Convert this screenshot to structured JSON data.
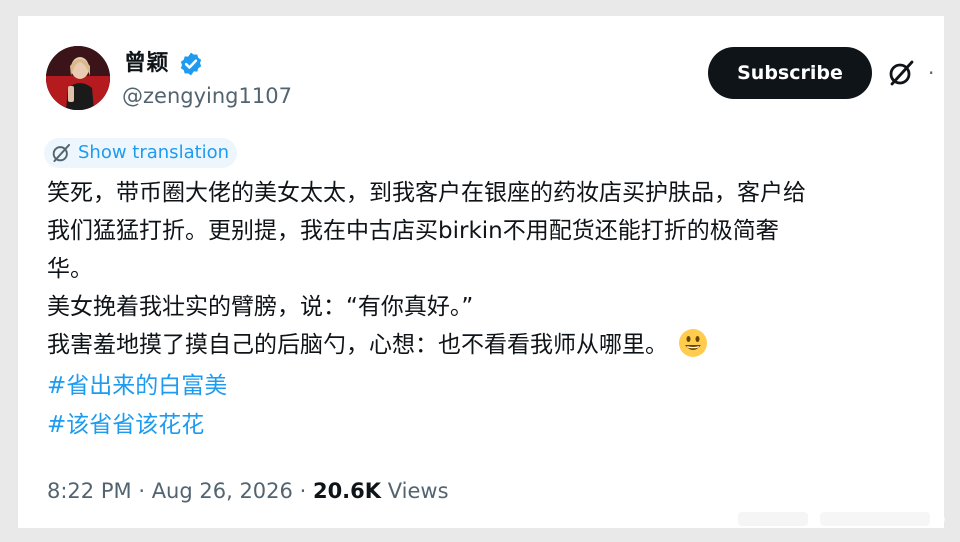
{
  "author": {
    "display_name": "曾颖",
    "handle": "@zengying1107",
    "avatar_icon": "user-avatar-photo",
    "verified_icon": "verified-badge-icon"
  },
  "actions": {
    "subscribe_label": "Subscribe",
    "grok_icon": "grok-slash-icon",
    "more_icon": "more-dots-icon"
  },
  "translation": {
    "label": "Show translation",
    "icon": "grok-slash-icon"
  },
  "tweet": {
    "lines": [
      "笑死，带币圈大佬的美女太太，到我客户在银座的药妆店买护肤品，客户给",
      "我们猛猛打折。更别提，我在中古店买birkin不用配货还能打折的极简奢",
      "华。",
      "美女挽着我壮实的臂膀，说：“有你真好。”",
      "我害羞地摸了摸自己的后脑勺，心想：也不看看我师从哪里。"
    ],
    "emoji": "smiling-face-emoji",
    "hashtags": [
      "#省出来的白富美",
      "#该省省该花花"
    ]
  },
  "meta": {
    "time": "8:22 PM",
    "separator": "·",
    "date": "Aug 26, 2026",
    "views_count": "20.6K",
    "views_label": "Views"
  },
  "colors": {
    "accent": "#1d9bf0",
    "text": "#0f1419",
    "secondary": "#536471",
    "button_bg": "#0f1419"
  }
}
